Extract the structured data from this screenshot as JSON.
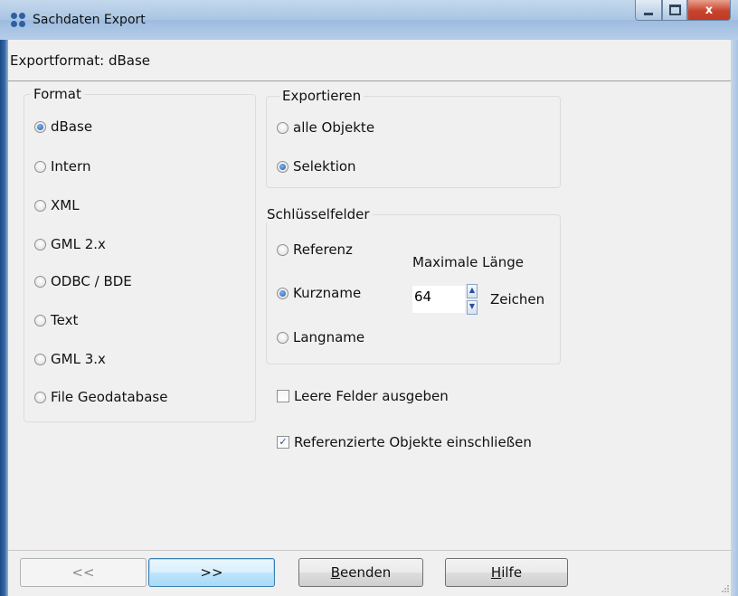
{
  "window": {
    "title": "Sachdaten Export",
    "close_glyph": "x"
  },
  "export_format": "Exportformat: dBase",
  "format_group": {
    "title": "Format",
    "options": [
      "dBase",
      "Intern",
      "XML",
      "GML 2.x",
      "ODBC / BDE",
      "Text",
      "GML 3.x",
      "File Geodatabase"
    ],
    "selected": "dBase"
  },
  "export_group": {
    "title": "Exportieren",
    "options": [
      "alle Objekte",
      "Selektion"
    ],
    "selected": "Selektion"
  },
  "key_group": {
    "title": "Schlüsselfelder",
    "options": [
      "Referenz",
      "Kurzname",
      "Langname"
    ],
    "selected": "Kurzname",
    "max_length_label": "Maximale Länge",
    "max_length_value": "64",
    "unit_label": "Zeichen"
  },
  "checkboxes": [
    {
      "label": "Leere Felder ausgeben",
      "checked": false
    },
    {
      "label": "Referenzierte Objekte einschließen",
      "checked": true
    }
  ],
  "buttons": {
    "back": "<<",
    "next": ">>",
    "finish_accel": "B",
    "finish_rest": "eenden",
    "help_accel": "H",
    "help_rest": "ilfe"
  },
  "icons": {
    "spin_up": "▲",
    "spin_down": "▼",
    "checkmark": "✓"
  }
}
